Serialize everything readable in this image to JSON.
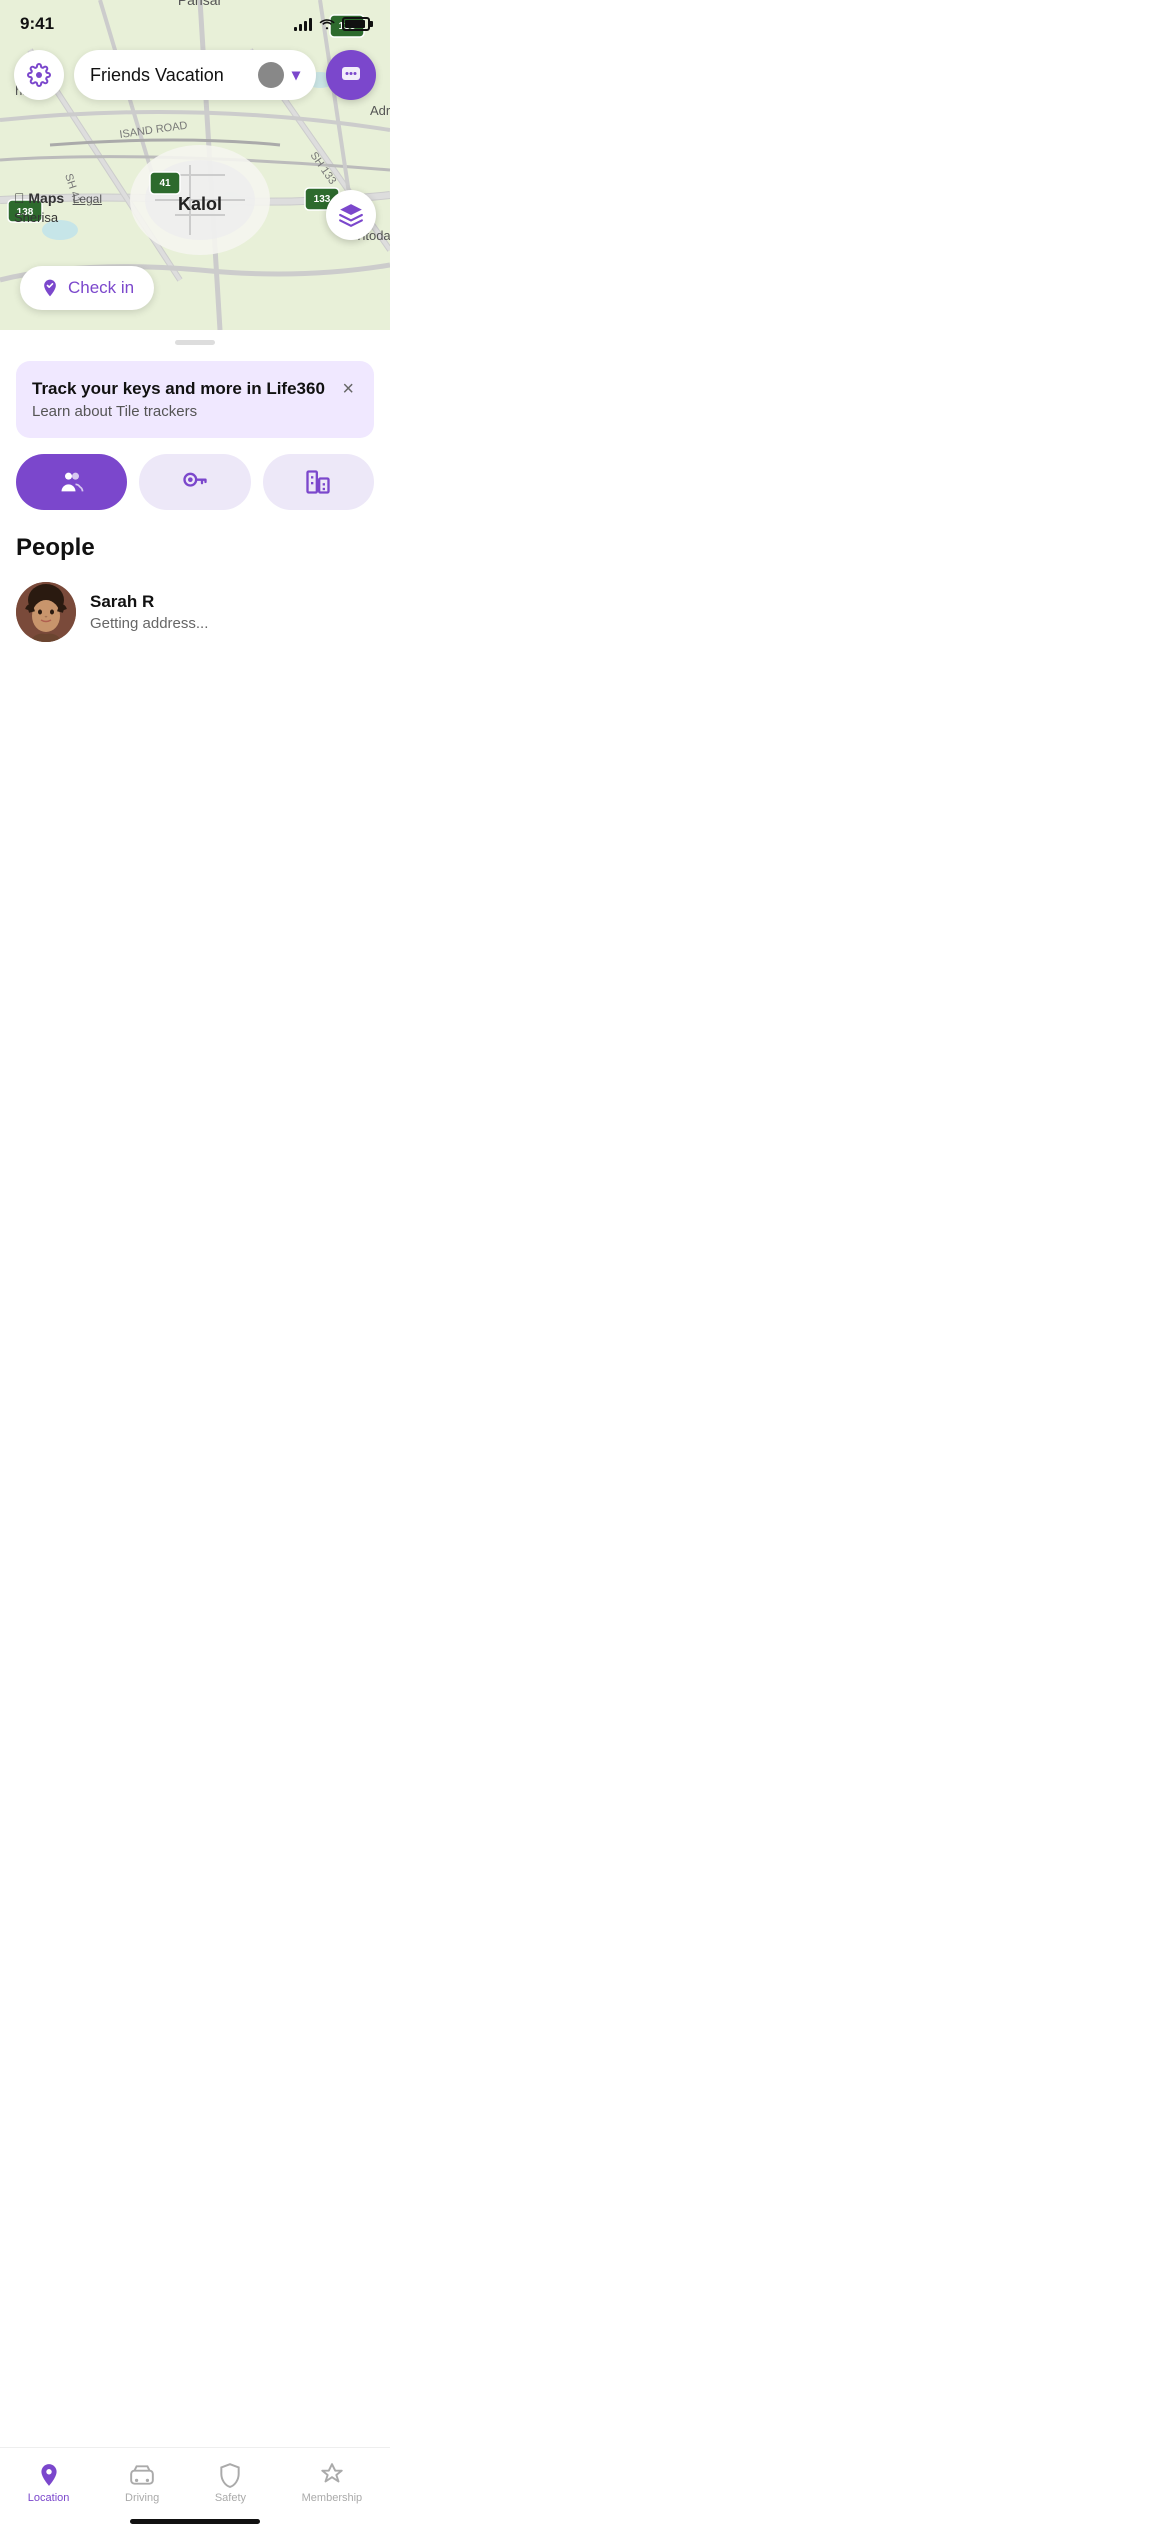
{
  "status": {
    "time": "9:41",
    "signal_bars": [
      4,
      7,
      10,
      13,
      16
    ],
    "battery_level": "90%"
  },
  "header": {
    "gear_label": "settings",
    "group_name": "Friends Vacation",
    "chat_label": "chat"
  },
  "map": {
    "city": "Kalol",
    "roads": [
      "ISAND ROAD",
      "SH 41",
      "SH 133"
    ],
    "route_signs": [
      "138",
      "41",
      "133"
    ],
    "nearby": [
      "Pansar",
      "hhatral",
      "Adr",
      "Titoda",
      "Sherisa"
    ],
    "layers_label": "layers",
    "checkin_label": "Check in",
    "maps_credit": "Maps",
    "maps_legal": "Legal",
    "maps_sherisa": "Sherisa"
  },
  "tile_banner": {
    "title": "Track your keys and more in Life360",
    "subtitle": "Learn about Tile trackers",
    "close_label": "×"
  },
  "quick_actions": {
    "people_icon": "👥",
    "tile_icon": "🔑",
    "building_icon": "🏢"
  },
  "people": {
    "section_title": "People",
    "items": [
      {
        "name": "Sarah R",
        "status": "Getting address..."
      }
    ]
  },
  "nav": {
    "items": [
      {
        "label": "Location",
        "active": true
      },
      {
        "label": "Driving",
        "active": false
      },
      {
        "label": "Safety",
        "active": false
      },
      {
        "label": "Membership",
        "active": false
      }
    ]
  }
}
